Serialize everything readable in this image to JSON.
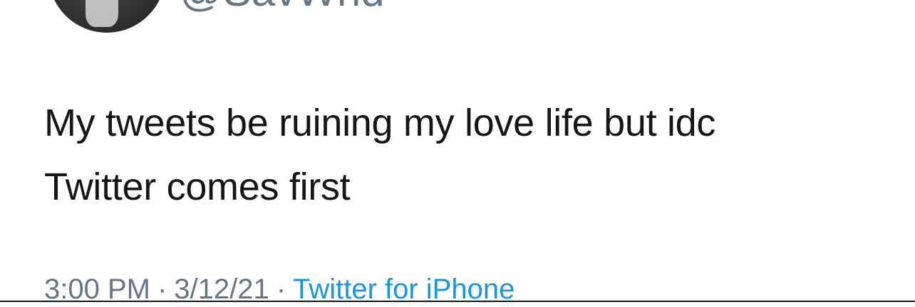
{
  "tweet": {
    "handle": "@SavWnd",
    "lines": [
      "My tweets be ruining my love life but idc",
      "Twitter comes first"
    ],
    "time": "3:00 PM",
    "date": "3/12/21",
    "separator": "·",
    "source": "Twitter for iPhone"
  },
  "colors": {
    "text": "#14171a",
    "secondary": "#657786",
    "link": "#1b95e0"
  }
}
